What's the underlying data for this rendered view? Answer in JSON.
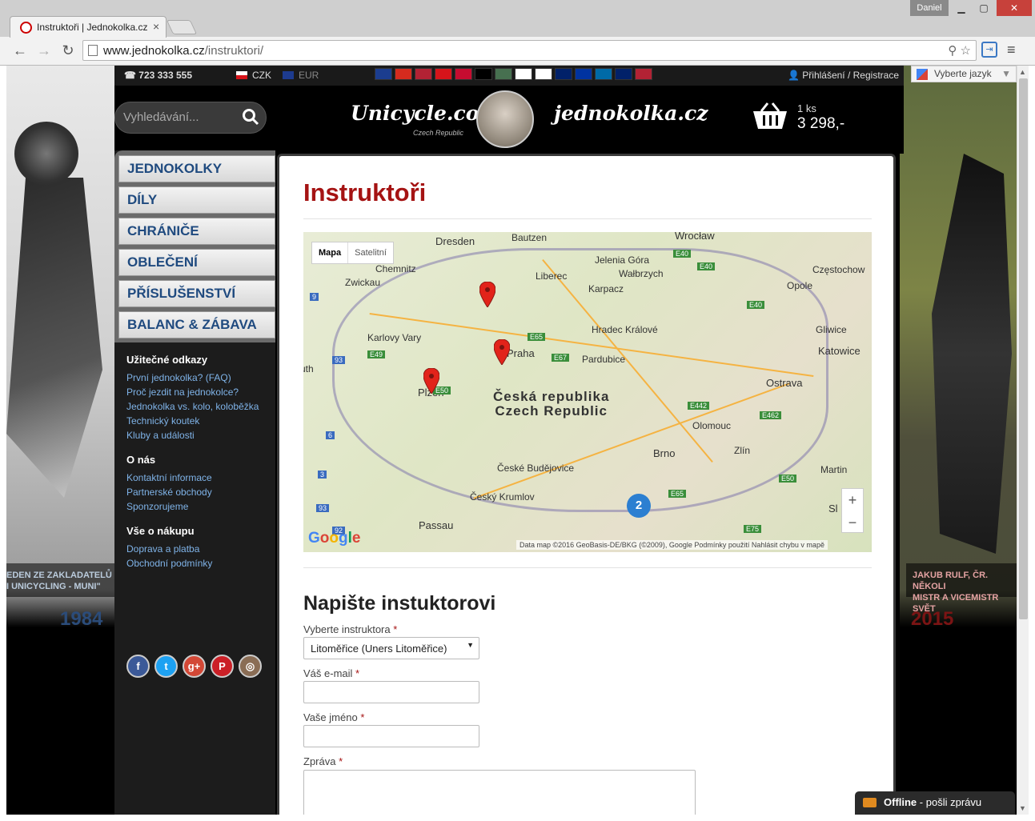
{
  "browser": {
    "tab_title": "Instruktoři | Jednokolka.cz",
    "user": "Daniel",
    "url_host": "www.jednokolka.cz",
    "url_path": "/instruktori/"
  },
  "site": {
    "phone": "723 333 555",
    "currency_czk": "CZK",
    "currency_eur": "EUR",
    "login": "Přihlášení / Registrace",
    "translate": "Vyberte jazyk",
    "search_placeholder": "Vyhledávání...",
    "logo_left": "Unicycle.com",
    "logo_left_sub": "Czech Republic",
    "logo_right": "jednokolka.cz",
    "cart_qty": "1 ks",
    "cart_total": "3 298,-",
    "flags": [
      "#1b3d8f",
      "#d52b1e",
      "#b22234",
      "#d7141a",
      "#c60c30",
      "#000000",
      "#477050",
      "#ffffff",
      "#ffffff",
      "#012169",
      "#0033a0",
      "#006aa7",
      "#012169",
      "#b22234"
    ]
  },
  "sidebar": {
    "categories": [
      "JEDNOKOLKY",
      "DÍLY",
      "CHRÁNIČE",
      "OBLEČENÍ",
      "PŘÍSLUŠENSTVÍ",
      "BALANC & ZÁBAVA"
    ],
    "useful_title": "Užitečné odkazy",
    "useful": [
      "První jednokolka? (FAQ)",
      "Proč jezdit na jednokolce?",
      "Jednokolka vs. kolo, koloběžka",
      "Technický koutek",
      "Kluby a události"
    ],
    "about_title": "O nás",
    "about": [
      "Kontaktní informace",
      "Partnerské obchody",
      "Sponzorujeme"
    ],
    "shop_title": "Vše o nákupu",
    "shop": [
      "Doprava a platba",
      "Obchodní podmínky"
    ]
  },
  "banners": {
    "left_caption_1": "EDEN ZE ZAKLADATELŮ",
    "left_caption_2": "I UNICYCLING - MUNI\"",
    "left_year": "1984",
    "right_caption_1": "JAKUB RULF, ČR. NĚKOLI",
    "right_caption_2": "MISTR A VICEMISTR SVĚT",
    "right_year": "2015"
  },
  "main": {
    "title": "Instruktoři",
    "map": {
      "type_map": "Mapa",
      "type_sat": "Satelitní",
      "country_cs": "Česká republika",
      "country_en": "Czech Republic",
      "cluster": "2",
      "attribution": "Data map ©2016 GeoBasis-DE/BKG (©2009), Google    Podmínky použití    Nahlásit chybu v mapě",
      "google": "Google"
    },
    "form_title": "Napište instuktorovi",
    "instructor_label": "Vyberte instruktora",
    "instructor_value": "Litoměřice (Uners Litoměřice)",
    "email_label": "Váš e-mail",
    "name_label": "Vaše jméno",
    "message_label": "Zpráva",
    "required": "*"
  },
  "chat": {
    "status": "Offline",
    "action": "- pošli zprávu"
  }
}
